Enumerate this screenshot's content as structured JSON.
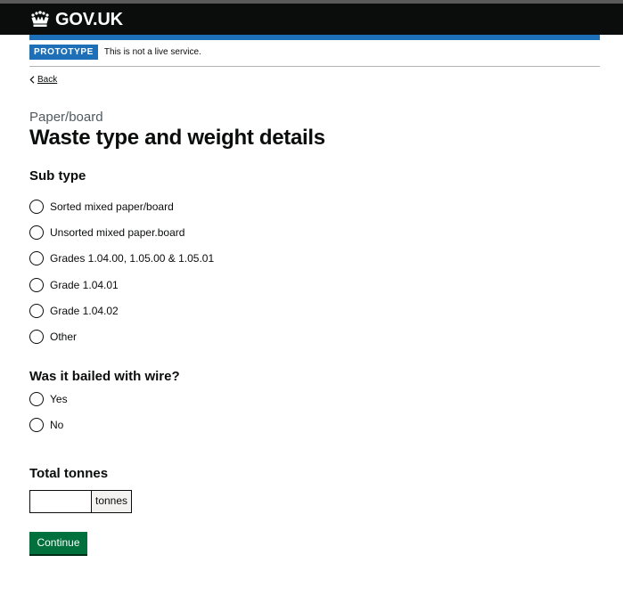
{
  "header": {
    "logo_text": "GOV.UK",
    "logo_icon": "crown-icon",
    "background": "#0b0c0c"
  },
  "phase_banner": {
    "tag": "PROTOTYPE",
    "text": "This is not a live service.",
    "tag_color": "#1d70b8"
  },
  "back_link": {
    "label": "Back",
    "icon": "chevron-left-icon"
  },
  "page": {
    "caption": "Paper/board",
    "title": "Waste type and weight details"
  },
  "sub_type": {
    "legend": "Sub type",
    "options": [
      {
        "label": "Sorted mixed paper/board",
        "checked": false
      },
      {
        "label": "Unsorted mixed paper.board",
        "checked": false
      },
      {
        "label": "Grades 1.04.00, 1.05.00 & 1.05.01",
        "checked": false
      },
      {
        "label": "Grade 1.04.01",
        "checked": false
      },
      {
        "label": "Grade 1.04.02",
        "checked": false
      },
      {
        "label": "Other",
        "checked": false
      }
    ]
  },
  "bailed": {
    "legend": "Was it bailed with wire?",
    "options": [
      {
        "label": "Yes",
        "checked": false
      },
      {
        "label": "No",
        "checked": false
      }
    ]
  },
  "total_tonnes": {
    "label": "Total tonnes",
    "value": "",
    "suffix": "tonnes"
  },
  "actions": {
    "continue_label": "Continue",
    "button_color": "#00703c"
  }
}
